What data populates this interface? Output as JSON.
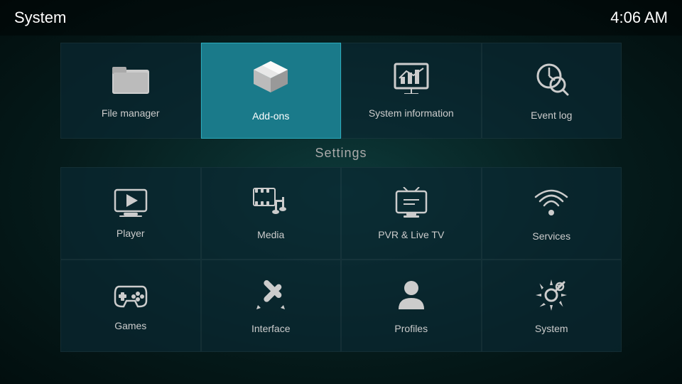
{
  "header": {
    "title": "System",
    "clock": "4:06 AM"
  },
  "top_items": [
    {
      "id": "file-manager",
      "label": "File manager",
      "icon": "folder"
    },
    {
      "id": "addons",
      "label": "Add-ons",
      "icon": "addons",
      "highlighted": true
    },
    {
      "id": "system-information",
      "label": "System information",
      "icon": "sysinfo"
    },
    {
      "id": "event-log",
      "label": "Event log",
      "icon": "eventlog"
    }
  ],
  "settings_label": "Settings",
  "grid_row1": [
    {
      "id": "player",
      "label": "Player",
      "icon": "player"
    },
    {
      "id": "media",
      "label": "Media",
      "icon": "media"
    },
    {
      "id": "pvr-live-tv",
      "label": "PVR & Live TV",
      "icon": "pvr"
    },
    {
      "id": "services",
      "label": "Services",
      "icon": "services"
    }
  ],
  "grid_row2": [
    {
      "id": "games",
      "label": "Games",
      "icon": "games"
    },
    {
      "id": "interface",
      "label": "Interface",
      "icon": "interface"
    },
    {
      "id": "profiles",
      "label": "Profiles",
      "icon": "profiles"
    },
    {
      "id": "system",
      "label": "System",
      "icon": "system"
    }
  ]
}
